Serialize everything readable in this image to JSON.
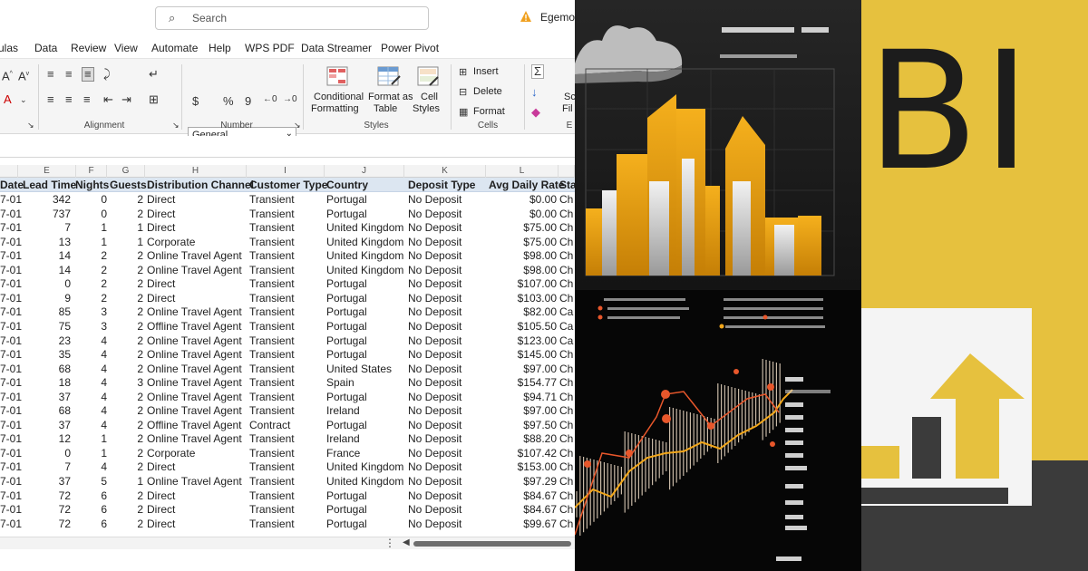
{
  "excel": {
    "search": {
      "placeholder": "Search"
    },
    "user_name": "Egemol",
    "menu": [
      "ulas",
      "Data",
      "Review",
      "View",
      "Automate",
      "Help",
      "WPS PDF",
      "Data Streamer",
      "Power Pivot"
    ],
    "ribbon": {
      "number_format": "General",
      "groups": {
        "alignment": "Alignment",
        "number": "Number",
        "styles": "Styles",
        "cells": "Cells",
        "editing": "E"
      },
      "conditional_formatting": [
        "Conditional",
        "Formatting"
      ],
      "format_as_table": [
        "Format as",
        "Table"
      ],
      "cell_styles": [
        "Cell",
        "Styles"
      ],
      "insert": "Insert",
      "delete": "Delete",
      "format": "Format",
      "sc": "Sc",
      "fi": "Fil",
      "currency": "$",
      "percent": "%",
      "comma": "9"
    },
    "column_letters": [
      "E",
      "F",
      "G",
      "H",
      "I",
      "J",
      "K",
      "L"
    ],
    "headers": [
      "Date",
      "Lead Time",
      "Nights",
      "Guests",
      "Distribution Channel",
      "Customer Type",
      "Country",
      "Deposit Type",
      "Avg Daily Rate",
      "Sta"
    ],
    "rows": [
      [
        "7-01",
        "342",
        "0",
        "2",
        "Direct",
        "Transient",
        "Portugal",
        "No Deposit",
        "$0.00",
        "Ch"
      ],
      [
        "7-01",
        "737",
        "0",
        "2",
        "Direct",
        "Transient",
        "Portugal",
        "No Deposit",
        "$0.00",
        "Ch"
      ],
      [
        "7-01",
        "7",
        "1",
        "1",
        "Direct",
        "Transient",
        "United Kingdom",
        "No Deposit",
        "$75.00",
        "Ch"
      ],
      [
        "7-01",
        "13",
        "1",
        "1",
        "Corporate",
        "Transient",
        "United Kingdom",
        "No Deposit",
        "$75.00",
        "Ch"
      ],
      [
        "7-01",
        "14",
        "2",
        "2",
        "Online Travel Agent",
        "Transient",
        "United Kingdom",
        "No Deposit",
        "$98.00",
        "Ch"
      ],
      [
        "7-01",
        "14",
        "2",
        "2",
        "Online Travel Agent",
        "Transient",
        "United Kingdom",
        "No Deposit",
        "$98.00",
        "Ch"
      ],
      [
        "7-01",
        "0",
        "2",
        "2",
        "Direct",
        "Transient",
        "Portugal",
        "No Deposit",
        "$107.00",
        "Ch"
      ],
      [
        "7-01",
        "9",
        "2",
        "2",
        "Direct",
        "Transient",
        "Portugal",
        "No Deposit",
        "$103.00",
        "Ch"
      ],
      [
        "7-01",
        "85",
        "3",
        "2",
        "Online Travel Agent",
        "Transient",
        "Portugal",
        "No Deposit",
        "$82.00",
        "Ca"
      ],
      [
        "7-01",
        "75",
        "3",
        "2",
        "Offline Travel Agent",
        "Transient",
        "Portugal",
        "No Deposit",
        "$105.50",
        "Ca"
      ],
      [
        "7-01",
        "23",
        "4",
        "2",
        "Online Travel Agent",
        "Transient",
        "Portugal",
        "No Deposit",
        "$123.00",
        "Ca"
      ],
      [
        "7-01",
        "35",
        "4",
        "2",
        "Online Travel Agent",
        "Transient",
        "Portugal",
        "No Deposit",
        "$145.00",
        "Ch"
      ],
      [
        "7-01",
        "68",
        "4",
        "2",
        "Online Travel Agent",
        "Transient",
        "United States",
        "No Deposit",
        "$97.00",
        "Ch"
      ],
      [
        "7-01",
        "18",
        "4",
        "3",
        "Online Travel Agent",
        "Transient",
        "Spain",
        "No Deposit",
        "$154.77",
        "Ch"
      ],
      [
        "7-01",
        "37",
        "4",
        "2",
        "Online Travel Agent",
        "Transient",
        "Portugal",
        "No Deposit",
        "$94.71",
        "Ch"
      ],
      [
        "7-01",
        "68",
        "4",
        "2",
        "Online Travel Agent",
        "Transient",
        "Ireland",
        "No Deposit",
        "$97.00",
        "Ch"
      ],
      [
        "7-01",
        "37",
        "4",
        "2",
        "Offline Travel Agent",
        "Contract",
        "Portugal",
        "No Deposit",
        "$97.50",
        "Ch"
      ],
      [
        "7-01",
        "12",
        "1",
        "2",
        "Online Travel Agent",
        "Transient",
        "Ireland",
        "No Deposit",
        "$88.20",
        "Ch"
      ],
      [
        "7-01",
        "0",
        "1",
        "2",
        "Corporate",
        "Transient",
        "France",
        "No Deposit",
        "$107.42",
        "Ch"
      ],
      [
        "7-01",
        "7",
        "4",
        "2",
        "Direct",
        "Transient",
        "United Kingdom",
        "No Deposit",
        "$153.00",
        "Ch"
      ],
      [
        "7-01",
        "37",
        "5",
        "1",
        "Online Travel Agent",
        "Transient",
        "United Kingdom",
        "No Deposit",
        "$97.29",
        "Ch"
      ],
      [
        "7-01",
        "72",
        "6",
        "2",
        "Direct",
        "Transient",
        "Portugal",
        "No Deposit",
        "$84.67",
        "Ch"
      ],
      [
        "7-01",
        "72",
        "6",
        "2",
        "Direct",
        "Transient",
        "Portugal",
        "No Deposit",
        "$84.67",
        "Ch"
      ],
      [
        "7-01",
        "72",
        "6",
        "2",
        "Direct",
        "Transient",
        "Portugal",
        "No Deposit",
        "$99.67",
        "Ch"
      ]
    ]
  },
  "bi_logo": {
    "text": "BI"
  },
  "colors": {
    "excel_header_fill": "#dce6f1",
    "chart_orange": "#f2a71b",
    "chart_red": "#e8572b",
    "bi_yellow": "#e6c13e",
    "bi_dark": "#3b3b3b"
  }
}
